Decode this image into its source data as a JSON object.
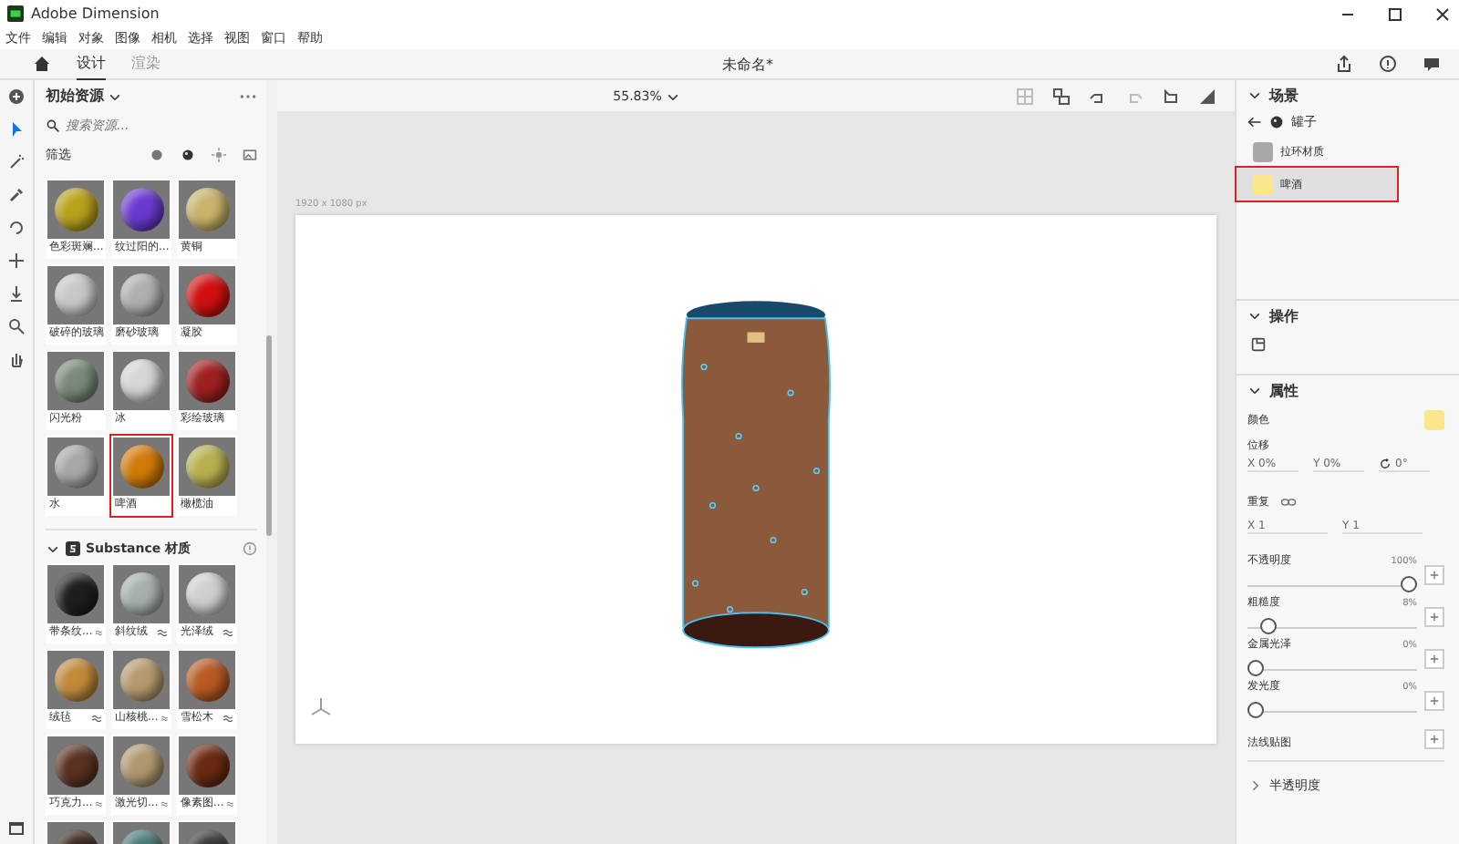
{
  "window": {
    "title": "Adobe Dimension"
  },
  "menu": [
    "文件",
    "编辑",
    "对象",
    "图像",
    "相机",
    "选择",
    "视图",
    "窗口",
    "帮助"
  ],
  "top_tabs": [
    {
      "label": "设计",
      "selected": true
    },
    {
      "label": "渲染",
      "selected": false
    }
  ],
  "document_title": "未命名*",
  "zoom": "55.83%",
  "left_panel": {
    "title": "初始资源",
    "search": {
      "placeholder": "搜索资源..."
    },
    "filter_label": "筛选",
    "materials": [
      {
        "label": "色彩斑斓...",
        "color": "#b8a21a",
        "highlighted": false
      },
      {
        "label": "纹过阳的...",
        "color": "#6a3ad0",
        "highlighted": false
      },
      {
        "label": "黄铜",
        "color": "#c9b46a",
        "highlighted": false
      },
      {
        "label": "破碎的玻璃",
        "color": "#c8c8c8",
        "highlighted": false
      },
      {
        "label": "磨砂玻璃",
        "color": "#b0b0b0",
        "highlighted": false
      },
      {
        "label": "凝胶",
        "color": "#d01010",
        "highlighted": false
      },
      {
        "label": "闪光粉",
        "color": "#7a8a7a",
        "highlighted": false
      },
      {
        "label": "冰",
        "color": "#d6d6d6",
        "highlighted": false
      },
      {
        "label": "彩绘玻璃",
        "color": "#a02020",
        "highlighted": false
      },
      {
        "label": "水",
        "color": "#a8a8a8",
        "highlighted": false
      },
      {
        "label": "啤酒",
        "color": "#d27a08",
        "highlighted": true
      },
      {
        "label": "橄榄油",
        "color": "#b8b050",
        "highlighted": false
      }
    ],
    "substance_title": "Substance 材质",
    "substance_materials": [
      {
        "label": "带条纹...",
        "color": "#1e1e1e"
      },
      {
        "label": "斜纹绒",
        "color": "#a8b0ac"
      },
      {
        "label": "光泽绒",
        "color": "#d0d0d0"
      },
      {
        "label": "绒毡",
        "color": "#c08a3a"
      },
      {
        "label": "山核桃...",
        "color": "#b89a70"
      },
      {
        "label": "雪松木",
        "color": "#b85a22"
      },
      {
        "label": "巧克力...",
        "color": "#5a3222"
      },
      {
        "label": "激光切...",
        "color": "#b09870"
      },
      {
        "label": "像素图...",
        "color": "#6a2a12"
      }
    ],
    "substance_partial": [
      {
        "color": "#3a2a22"
      },
      {
        "color": "#4a7a78"
      },
      {
        "color": "#3a3a3a"
      }
    ]
  },
  "canvas": {
    "size_label": "1920 x 1080 px"
  },
  "right_panel": {
    "scene_title": "场景",
    "group_name": "罐子",
    "scene_items": [
      {
        "label": "拉环材质",
        "color": "#a8a8a8",
        "selected": false,
        "highlighted": false
      },
      {
        "label": "啤酒",
        "color": "#fce68a",
        "selected": true,
        "highlighted": true
      }
    ],
    "actions_title": "操作",
    "properties_title": "属性",
    "color_label": "颜色",
    "color": "#fce68a",
    "offset_label": "位移",
    "offset_x": "X 0%",
    "offset_y": "Y 0%",
    "rotation": "0°",
    "repeat_label": "重复",
    "repeat_x": "X 1",
    "repeat_y": "Y 1",
    "sliders": [
      {
        "label": "不透明度",
        "reading": "100%",
        "level": 1
      },
      {
        "label": "粗糙度",
        "reading": "8%",
        "level": 0.08
      },
      {
        "label": "金属光泽",
        "reading": "0%",
        "level": 0
      },
      {
        "label": "发光度",
        "reading": "0%",
        "level": 0
      }
    ],
    "normal_map_label": "法线贴图",
    "translucency_title": "半透明度",
    "translucency_expanded": false
  }
}
